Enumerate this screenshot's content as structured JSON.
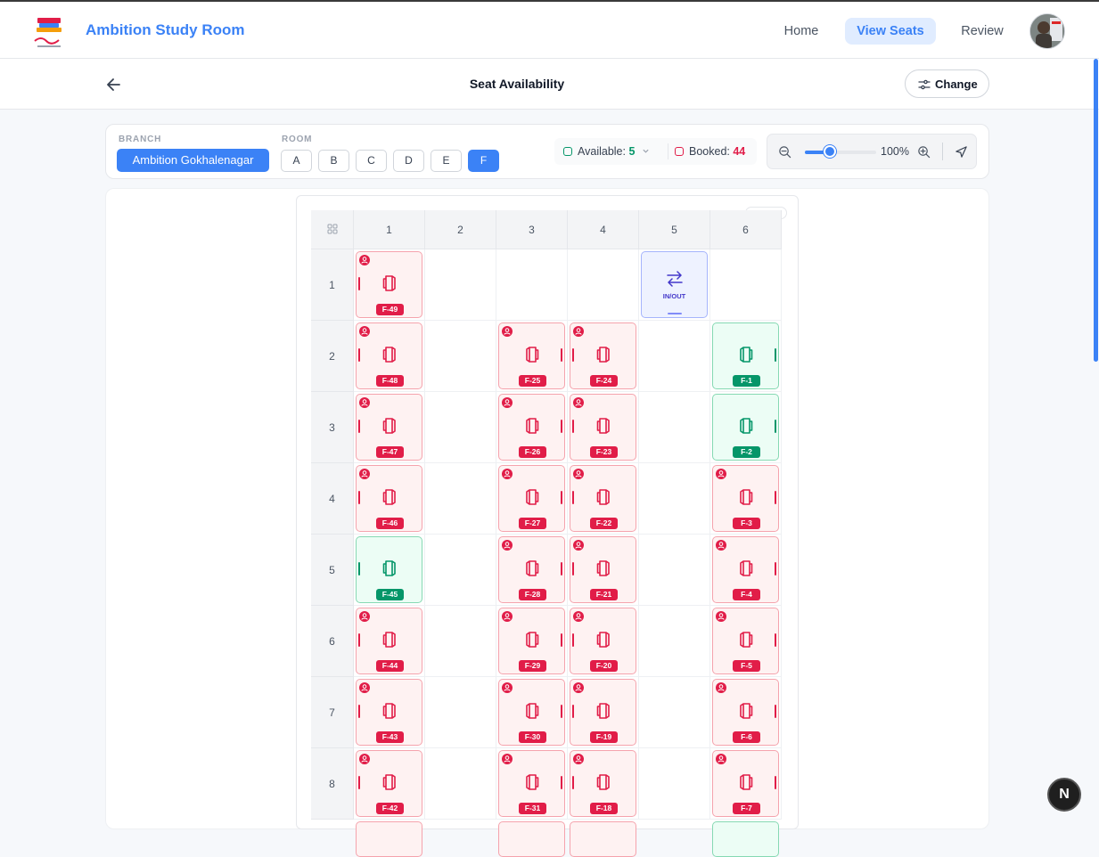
{
  "header": {
    "brand": "Ambition Study Room",
    "nav": [
      {
        "label": "Home",
        "active": false
      },
      {
        "label": "View Seats",
        "active": true
      },
      {
        "label": "Review",
        "active": false
      }
    ]
  },
  "subheader": {
    "title": "Seat Availability",
    "change_label": "Change"
  },
  "filters": {
    "branch_label": "BRANCH",
    "branch_value": "Ambition Gokhalenagar",
    "room_label": "ROOM",
    "rooms": [
      "A",
      "B",
      "C",
      "D",
      "E",
      "F"
    ],
    "active_room": "F",
    "available_label": "Available:",
    "available_count": "5",
    "booked_label": "Booked:",
    "booked_count": "44",
    "zoom_value": "100%",
    "zoom_fraction": 0.35
  },
  "colors": {
    "accent": "#3b82f6",
    "booked": "#e11d48",
    "available": "#059669"
  },
  "seat_map": {
    "columns": [
      "1",
      "2",
      "3",
      "4",
      "5",
      "6"
    ],
    "rows": [
      "1",
      "2",
      "3",
      "4",
      "5",
      "6",
      "7",
      "8"
    ],
    "inout_label": "IN/OUT",
    "cells": [
      {
        "row": 1,
        "col": 1,
        "type": "seat",
        "label": "F-49",
        "status": "booked"
      },
      {
        "row": 1,
        "col": 5,
        "type": "inout"
      },
      {
        "row": 2,
        "col": 1,
        "type": "seat",
        "label": "F-48",
        "status": "booked"
      },
      {
        "row": 2,
        "col": 3,
        "type": "seat",
        "label": "F-25",
        "status": "booked",
        "flip": true
      },
      {
        "row": 2,
        "col": 4,
        "type": "seat",
        "label": "F-24",
        "status": "booked"
      },
      {
        "row": 2,
        "col": 6,
        "type": "seat",
        "label": "F-1",
        "status": "available",
        "flip": true
      },
      {
        "row": 3,
        "col": 1,
        "type": "seat",
        "label": "F-47",
        "status": "booked"
      },
      {
        "row": 3,
        "col": 3,
        "type": "seat",
        "label": "F-26",
        "status": "booked",
        "flip": true
      },
      {
        "row": 3,
        "col": 4,
        "type": "seat",
        "label": "F-23",
        "status": "booked"
      },
      {
        "row": 3,
        "col": 6,
        "type": "seat",
        "label": "F-2",
        "status": "available",
        "flip": true
      },
      {
        "row": 4,
        "col": 1,
        "type": "seat",
        "label": "F-46",
        "status": "booked"
      },
      {
        "row": 4,
        "col": 3,
        "type": "seat",
        "label": "F-27",
        "status": "booked",
        "flip": true
      },
      {
        "row": 4,
        "col": 4,
        "type": "seat",
        "label": "F-22",
        "status": "booked"
      },
      {
        "row": 4,
        "col": 6,
        "type": "seat",
        "label": "F-3",
        "status": "booked",
        "flip": true
      },
      {
        "row": 5,
        "col": 1,
        "type": "seat",
        "label": "F-45",
        "status": "available"
      },
      {
        "row": 5,
        "col": 3,
        "type": "seat",
        "label": "F-28",
        "status": "booked",
        "flip": true
      },
      {
        "row": 5,
        "col": 4,
        "type": "seat",
        "label": "F-21",
        "status": "booked"
      },
      {
        "row": 5,
        "col": 6,
        "type": "seat",
        "label": "F-4",
        "status": "booked",
        "flip": true
      },
      {
        "row": 6,
        "col": 1,
        "type": "seat",
        "label": "F-44",
        "status": "booked"
      },
      {
        "row": 6,
        "col": 3,
        "type": "seat",
        "label": "F-29",
        "status": "booked",
        "flip": true
      },
      {
        "row": 6,
        "col": 4,
        "type": "seat",
        "label": "F-20",
        "status": "booked"
      },
      {
        "row": 6,
        "col": 6,
        "type": "seat",
        "label": "F-5",
        "status": "booked",
        "flip": true
      },
      {
        "row": 7,
        "col": 1,
        "type": "seat",
        "label": "F-43",
        "status": "booked"
      },
      {
        "row": 7,
        "col": 3,
        "type": "seat",
        "label": "F-30",
        "status": "booked",
        "flip": true
      },
      {
        "row": 7,
        "col": 4,
        "type": "seat",
        "label": "F-19",
        "status": "booked"
      },
      {
        "row": 7,
        "col": 6,
        "type": "seat",
        "label": "F-6",
        "status": "booked",
        "flip": true
      },
      {
        "row": 8,
        "col": 1,
        "type": "seat",
        "label": "F-42",
        "status": "booked"
      },
      {
        "row": 8,
        "col": 3,
        "type": "seat",
        "label": "F-31",
        "status": "booked",
        "flip": true
      },
      {
        "row": 8,
        "col": 4,
        "type": "seat",
        "label": "F-18",
        "status": "booked"
      },
      {
        "row": 8,
        "col": 6,
        "type": "seat",
        "label": "F-7",
        "status": "booked",
        "flip": true
      }
    ]
  },
  "dev_badge": "N"
}
